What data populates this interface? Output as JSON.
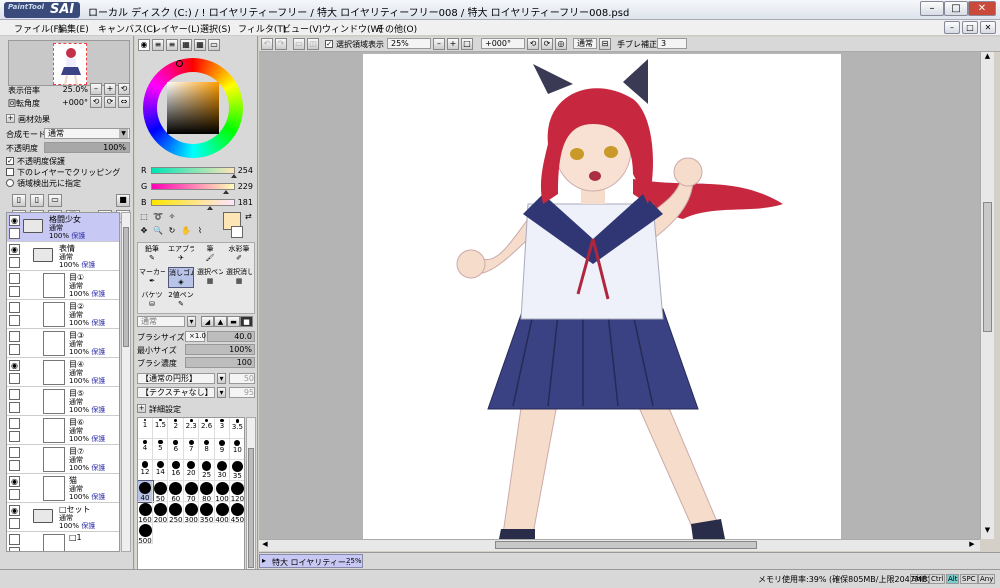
{
  "window": {
    "title": "ローカル ディスク (C:) / ! ロイヤリティーフリー / 特大 ロイヤリティーフリー008 / 特大 ロイヤリティーフリー008.psd",
    "logo_small": "PaintTool",
    "logo_big": "SAI",
    "min": "–",
    "max": "□",
    "close": "✕",
    "close_color": "#c94a3a"
  },
  "menu": {
    "items": [
      "ファイル(F)",
      "編集(E)",
      "キャンバス(C)",
      "レイヤー(L)",
      "選択(S)",
      "フィルタ(T)",
      "ビュー(V)",
      "ウィンドウ(W)",
      "その他(O)"
    ],
    "mdi_min": "–",
    "mdi_max": "□",
    "mdi_close": "✕"
  },
  "navigator": {
    "zoom_label": "表示倍率",
    "zoom_value": "25.0%",
    "angle_label": "回転角度",
    "angle_value": "+000°",
    "btn_minus": "–",
    "btn_plus": "+",
    "btn_reset": "⟲",
    "btn_flip": "⇔"
  },
  "layer_panel": {
    "paper_effect": "画材効果",
    "blend_label": "合成モード",
    "blend_value": "通常",
    "opacity_label": "不透明度",
    "opacity_value": "100%",
    "opacity_level": 1.0,
    "preserve_opacity": "不透明度保護",
    "preserve_opacity_checked": true,
    "clip_label": "下のレイヤーでクリッピング",
    "clip_checked": false,
    "selection_source": "領域検出元に指定",
    "selection_source_checked": false,
    "layers": [
      {
        "name": "格闘少女",
        "mode": "通常",
        "opacity": "100%",
        "extra": "保護",
        "kind": "folder",
        "visible": true,
        "selected": true
      },
      {
        "name": "表情",
        "mode": "通常",
        "opacity": "100%",
        "extra": "保護",
        "kind": "folder",
        "visible": true,
        "selected": false
      },
      {
        "name": "目①",
        "mode": "通常",
        "opacity": "100%",
        "extra": "保護",
        "kind": "layer",
        "visible": false,
        "selected": false
      },
      {
        "name": "目②",
        "mode": "通常",
        "opacity": "100%",
        "extra": "保護",
        "kind": "layer",
        "visible": false,
        "selected": false
      },
      {
        "name": "目③",
        "mode": "通常",
        "opacity": "100%",
        "extra": "保護",
        "kind": "layer",
        "visible": false,
        "selected": false
      },
      {
        "name": "目④",
        "mode": "通常",
        "opacity": "100%",
        "extra": "保護",
        "kind": "layer",
        "visible": true,
        "selected": false
      },
      {
        "name": "目⑤",
        "mode": "通常",
        "opacity": "100%",
        "extra": "保護",
        "kind": "layer",
        "visible": false,
        "selected": false
      },
      {
        "name": "目⑥",
        "mode": "通常",
        "opacity": "100%",
        "extra": "保護",
        "kind": "layer",
        "visible": false,
        "selected": false
      },
      {
        "name": "目⑦",
        "mode": "通常",
        "opacity": "100%",
        "extra": "保護",
        "kind": "layer",
        "visible": false,
        "selected": false
      },
      {
        "name": "猫",
        "mode": "通常",
        "opacity": "100%",
        "extra": "保護",
        "kind": "layer",
        "visible": true,
        "selected": false
      },
      {
        "name": "□セット",
        "mode": "通常",
        "opacity": "100%",
        "extra": "保護",
        "kind": "folder",
        "visible": true,
        "selected": false
      },
      {
        "name": "□1",
        "mode": "",
        "opacity": "",
        "extra": "",
        "kind": "layer",
        "visible": false,
        "selected": false
      }
    ]
  },
  "color_panel": {
    "r_label": "R",
    "r_value": "254",
    "r_level": 0.996,
    "g_label": "G",
    "g_value": "229",
    "g_level": 0.898,
    "b_label": "B",
    "b_value": "181",
    "b_level": 0.71,
    "fg_color": "#fee5b5",
    "bg_color": "#ffffff"
  },
  "tools": {
    "row1": [
      "鉛筆",
      "エアブラシ",
      "筆",
      "水彩筆"
    ],
    "row2": [
      "マーカー",
      "消しゴム",
      "選択ペン",
      "選択消し"
    ],
    "row3": [
      "バケツ",
      "2値ペン",
      "",
      ""
    ],
    "selected": "消しゴム",
    "mode_value": "通常",
    "brush_size_label": "ブラシサイズ",
    "brush_size_mult": "×1.0",
    "brush_size_value": "40.0",
    "min_size_label": "最小サイズ",
    "min_size_value": "100%",
    "density_label": "ブラシ濃度",
    "density_value": "100",
    "shape_label": "【通常の円形】",
    "shape_value": "50",
    "texture_label": "【テクスチャなし】",
    "texture_value": "95",
    "detail_label": "詳細設定"
  },
  "brush_sizes": [
    "1",
    "1.5",
    "2",
    "2.3",
    "2.6",
    "3",
    "3.5",
    "4",
    "5",
    "6",
    "7",
    "8",
    "9",
    "10",
    "12",
    "14",
    "16",
    "20",
    "25",
    "30",
    "35",
    "40",
    "50",
    "60",
    "70",
    "80",
    "100",
    "120",
    "160",
    "200",
    "250",
    "300",
    "350",
    "400",
    "450",
    "500"
  ],
  "brush_selected": "40",
  "toolbar": {
    "show_selection": "選択領域表示",
    "show_selection_checked": true,
    "zoom": "25%",
    "angle": "+000°",
    "mode": "通常",
    "stabilizer_label": "手ブレ補正",
    "stabilizer_value": "3"
  },
  "tab": {
    "name": "特大 ロイヤリティー..",
    "zoom": "25%"
  },
  "status": {
    "memory": "メモリ使用率:39% (確保805MB/上限2047MB)",
    "keys": [
      "Shift",
      "Ctrl",
      "Alt",
      "SPC",
      "Any"
    ]
  }
}
